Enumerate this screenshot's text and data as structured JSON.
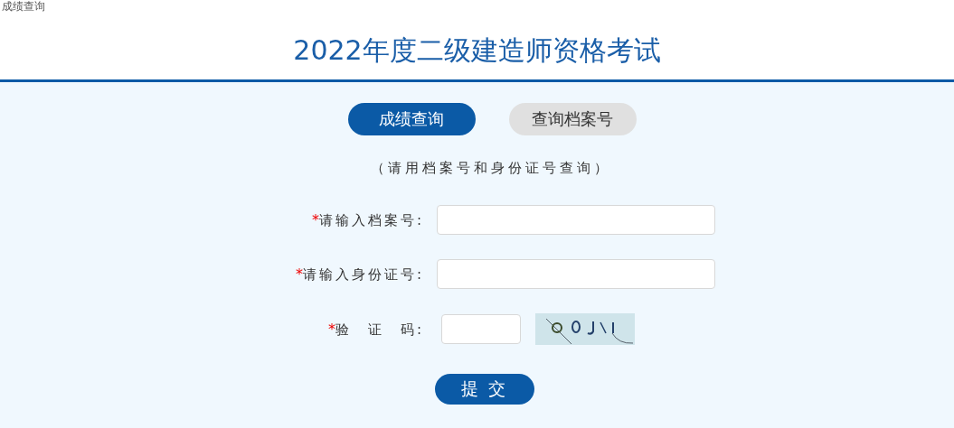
{
  "breadcrumb": "成绩查询",
  "title": "2022年度二级建造师资格考试",
  "tabs": [
    {
      "label": "成绩查询",
      "selected": true
    },
    {
      "label": "查询档案号",
      "selected": false
    }
  ],
  "hint": "（请用档案号和身份证号查询）",
  "fields": [
    {
      "required_mark": "*",
      "label": "请输入档案号:",
      "kind": "text"
    },
    {
      "required_mark": "*",
      "label": "请输入身份证号:",
      "kind": "text"
    },
    {
      "required_mark": "*",
      "label": "验　证　码:",
      "kind": "captcha"
    }
  ],
  "submit": "提 交"
}
